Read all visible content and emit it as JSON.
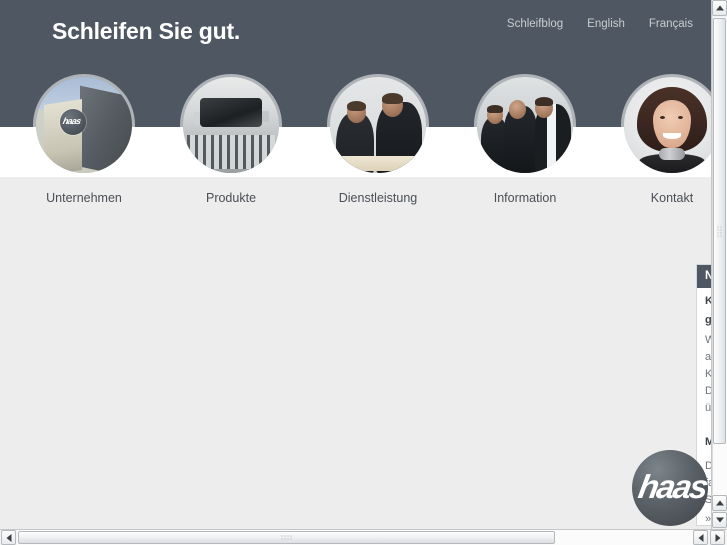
{
  "header": {
    "claim": "Schleifen Sie gut.",
    "lang_nav": [
      {
        "label": "Schleifblog"
      },
      {
        "label": "English"
      },
      {
        "label": "Français"
      }
    ]
  },
  "main_nav": [
    {
      "label": "Unternehmen",
      "image": "factory-building-photo"
    },
    {
      "label": "Produkte",
      "image": "grinding-machine-photo"
    },
    {
      "label": "Dienstleistung",
      "image": "two-engineers-at-worktable-photo"
    },
    {
      "label": "Information",
      "image": "three-men-in-workshop-photo"
    },
    {
      "label": "Kontakt",
      "image": "woman-portrait-photo"
    }
  ],
  "logo": {
    "wordmark": "haas",
    "alt": "haas-logo"
  },
  "teaser": {
    "blocks": [
      {
        "heading": "N",
        "title_line1": "K",
        "title_line2": "ge",
        "lines": [
          "W",
          "au",
          "Kr",
          "De",
          "üb"
        ],
        "more": "»"
      },
      {
        "heading": "M",
        "title_line1": "",
        "title_line2": "",
        "lines": [
          "D",
          "fa",
          "Si"
        ],
        "more": "»"
      }
    ]
  },
  "scrollbars": {
    "vertical": {
      "up_icon": "triangle-up-icon",
      "down_icon": "triangle-down-icon"
    },
    "horizontal": {
      "left_icon": "triangle-left-icon",
      "right_icon": "triangle-right-icon"
    }
  },
  "colors": {
    "header_bg": "#4f5862",
    "page_bg": "#ededed",
    "white_strip": "#ffffff",
    "nav_label": "#4a4f55",
    "lang_link": "#c8ccd1",
    "logo_dark": "#3f4449"
  }
}
